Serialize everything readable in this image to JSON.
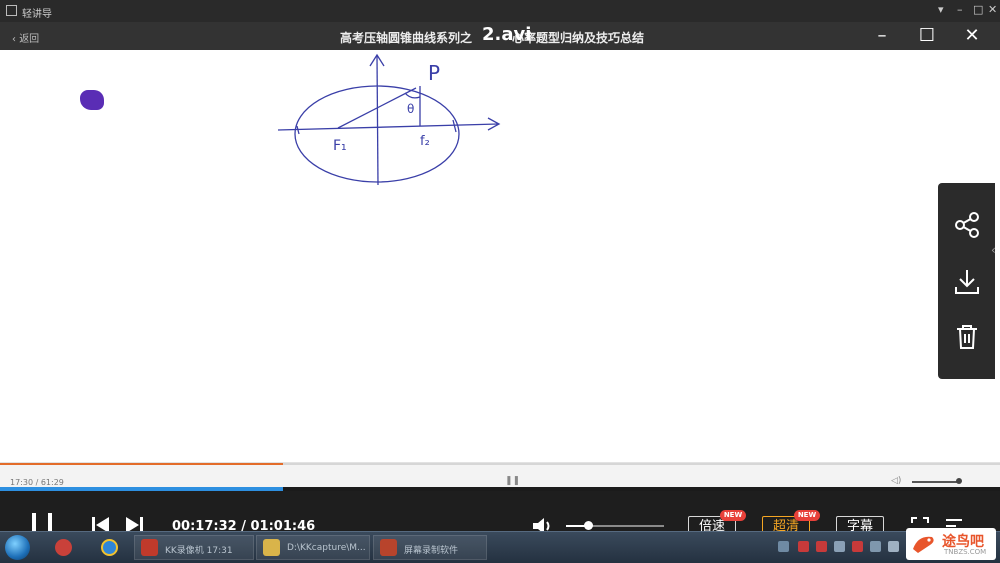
{
  "window": {
    "app_title": "轻讲导"
  },
  "header": {
    "back_label": "返回",
    "title": "高考压轴圆锥曲线系列之",
    "file_overlay": "2.avi",
    "title_tail": "心率题型归纳及技巧总结"
  },
  "board": {
    "labels": {
      "point_p": "P",
      "angle": "θ",
      "focus_1": "F₁",
      "focus_2": "f₂"
    }
  },
  "seek": {
    "time_mini": "17:30 / 61:29",
    "progress_fraction": 0.283
  },
  "controls": {
    "current_time": "00:17:32",
    "total_time": "01:01:46",
    "volume_fraction": 0.24,
    "speed_label": "倍速",
    "quality_label": "超清",
    "subtitle_label": "字幕",
    "new_badge": "NEW"
  },
  "taskbar": {
    "items": [
      {
        "label": "KK录像机 17:31"
      },
      {
        "label": "D:\\KKcapture\\M..."
      },
      {
        "label": "屏幕录制软件"
      }
    ]
  },
  "site_logo": {
    "text": "途鸟吧",
    "sub": "TNBZS.COM"
  },
  "colors": {
    "accent_orange": "#e36c2a",
    "progress_blue": "#2d8fe0",
    "quality_gold": "#f5a623",
    "badge_red": "#e8413a",
    "ink_blue": "#3a3fa8"
  },
  "icons": [
    "share-icon",
    "download-icon",
    "trash-icon",
    "volume-icon",
    "fullscreen-icon",
    "playlist-icon"
  ]
}
